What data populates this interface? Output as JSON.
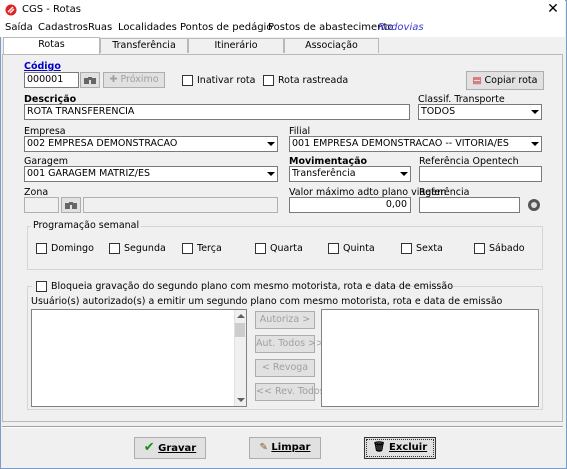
{
  "window": {
    "title": "CGS - Rotas"
  },
  "menu": [
    {
      "label": "Saída"
    },
    {
      "label": "Cadastros"
    },
    {
      "label": "Ruas"
    },
    {
      "label": "Localidades"
    },
    {
      "label": "Pontos de pedágio"
    },
    {
      "label": "Postos de abastecimento"
    },
    {
      "label": "Rodovias"
    }
  ],
  "tabs": [
    {
      "label": "Rotas",
      "active": true
    },
    {
      "label": "Transferência"
    },
    {
      "label": "Itinerário"
    },
    {
      "label": "Associação"
    }
  ],
  "form": {
    "codigo_label": "Código",
    "codigo_value": "000001",
    "proximo_label": "Próximo",
    "inativar_label": "Inativar rota",
    "rastreada_label": "Rota rastreada",
    "copiar_label": "Copiar rota",
    "descricao_label": "Descrição",
    "descricao_value": "ROTA TRANSFERENCIA",
    "classif_label": "Classif. Transporte",
    "classif_value": "TODOS",
    "empresa_label": "Empresa",
    "empresa_value": "002 EMPRESA DEMONSTRACAO",
    "filial_label": "Filial",
    "filial_value": "001 EMPRESA DEMONSTRACAO -- VITORIA/ES",
    "garagem_label": "Garagem",
    "garagem_value": "001 GARAGEM MATRIZ/ES",
    "movimentacao_label": "Movimentação",
    "movimentacao_value": "Transferência",
    "ref_opentech_label": "Referência Opentech",
    "ref_opentech_value": "",
    "zona_label": "Zona",
    "zona_code": "",
    "zona_desc": "",
    "valor_label": "Valor máximo adto plano viagem",
    "valor_value": "0,00",
    "referencia_label": "Referência",
    "referencia_value": ""
  },
  "programacao": {
    "title": "Programação semanal",
    "days": [
      "Domingo",
      "Segunda",
      "Terça",
      "Quarta",
      "Quinta",
      "Sexta",
      "Sábado"
    ]
  },
  "bloqueio": {
    "checkbox_label": "Bloqueia gravação do segundo plano com mesmo motorista, rota e data de emissão",
    "users_label": "Usuário(s) autorizado(s) a emitir um segundo plano com mesmo motorista, rota e data de emissão",
    "autoriza": "Autoriza >",
    "aut_todos": "Aut. Todos >>",
    "revoga": "< Revoga",
    "rev_todos": "<< Rev. Todos"
  },
  "actions": {
    "gravar": "Gravar",
    "limpar": "Limpar",
    "excluir": "Excluir"
  },
  "colors": {
    "accent_blue": "#3c3cd6",
    "gravar_check": "#1a8f1a"
  }
}
